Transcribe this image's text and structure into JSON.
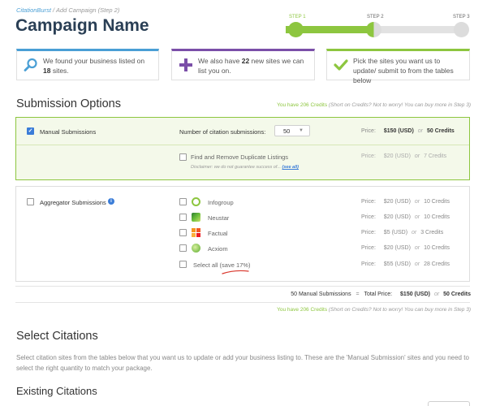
{
  "breadcrumb": {
    "link": "CitationBurst",
    "separator": "/",
    "current": "Add Campaign (Step 2)"
  },
  "page_title": "Campaign Name",
  "stepper": {
    "steps": [
      {
        "label": "STEP 1",
        "state": "complete"
      },
      {
        "label": "STEP 2",
        "state": "current"
      },
      {
        "label": "STEP 3",
        "state": "upcoming"
      }
    ],
    "progress": 0.5,
    "colors": {
      "done": "#8dc63f",
      "todo": "#e2e2e2"
    }
  },
  "info_cards": [
    {
      "icon": "search-icon",
      "pre": "We found your business listed on ",
      "bold": "18",
      "post": " sites.",
      "accent": "#4a9fd5"
    },
    {
      "icon": "plus-icon",
      "pre": "We also have ",
      "bold": "22",
      "post": " new sites we can list you on.",
      "accent": "#7b4fa8"
    },
    {
      "icon": "checkmark-icon",
      "pre": "Pick the sites you want us to update/ submit to from the tables below",
      "bold": "",
      "post": "",
      "accent": "#8dc63f"
    }
  ],
  "submission_options": {
    "title": "Submission Options",
    "credits": "You have 206 Credits",
    "credits_note": "(Short on Credits? Not to worry! You can buy more in Step 3)",
    "manual": {
      "label": "Manual Submissions",
      "checked": true,
      "quantity_label": "Number of citation submissions:",
      "quantity_value": "50",
      "price_label": "Price:",
      "price": "$150 (USD)",
      "or": "or",
      "credits": "50 Credits",
      "duplicate": {
        "label": "Find and Remove Duplicate Listings",
        "checked": false,
        "disclaimer": "Disclaimer: we do not guarantee success of...",
        "see_all": "(see all)",
        "price": "$20 (USD)",
        "credits": "7 Credits"
      }
    },
    "aggregator": {
      "label": "Aggregator Submissions",
      "checked": false,
      "info_icon": "info-icon",
      "items": [
        {
          "name": "Infogroup",
          "icon": "infogroup-logo-icon",
          "price": "$20 (USD)",
          "credits": "10 Credits",
          "checked": false
        },
        {
          "name": "Neustar",
          "icon": "neustar-logo-icon",
          "price": "$20 (USD)",
          "credits": "10 Credits",
          "checked": false
        },
        {
          "name": "Factual",
          "icon": "factual-logo-icon",
          "price": "$5 (USD)",
          "credits": "3 Credits",
          "checked": false
        },
        {
          "name": "Acxiom",
          "icon": "acxiom-logo-icon",
          "price": "$20 (USD)",
          "credits": "10 Credits",
          "checked": false
        }
      ],
      "select_all": {
        "label": "Select all",
        "save": "(save 17%)",
        "price": "$55 (USD)",
        "credits": "28 Credits",
        "checked": false
      }
    },
    "total": {
      "summary": "50 Manual Submissions",
      "equals": "=",
      "label": "Total Price:",
      "price": "$150 (USD)",
      "or": "or",
      "credits": "50 Credits"
    }
  },
  "select_citations": {
    "title": "Select Citations",
    "body": "Select citation sites from the tables below that you want us to update or add your business listing to. These are the 'Manual Submission' sites and you need to select the right quantity to match your package."
  },
  "existing_citations": {
    "title": "Existing Citations"
  }
}
